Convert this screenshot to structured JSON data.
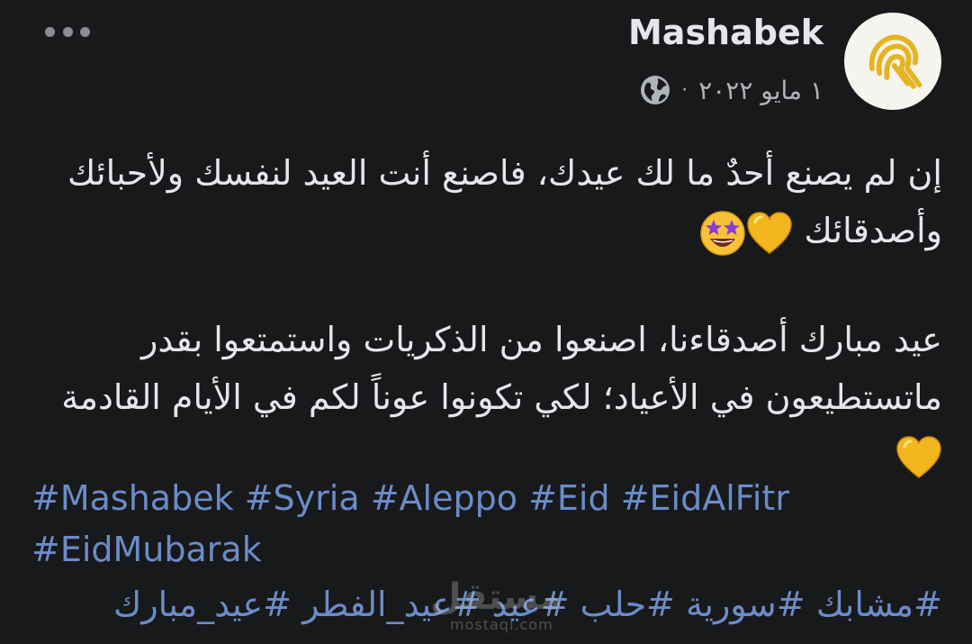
{
  "post": {
    "author": "Mashabek",
    "date": "١ مايو ٢٠٢٢",
    "separator": "·",
    "privacy_icon": "globe-icon",
    "avatar_icon": "fingerprint-logo",
    "more_icon": "more-dots-icon",
    "body": {
      "paragraph1": "إن لم يصنع أحدٌ ما لك عيدك، فاصنع أنت العيد لنفسك ولأحبائك وأصدقائك",
      "paragraph1_emojis": [
        "yellow-heart-emoji",
        "star-struck-emoji"
      ],
      "paragraph2": "عيد مبارك أصدقاءنا، اصنعوا من الذكريات واستمتعوا بقدر ماتستطيعون في الأعياد؛ لكي تكونوا عوناً لكم في الأيام القادمة",
      "paragraph2_emojis": [
        "yellow-heart-emoji"
      ]
    },
    "hashtags_en": [
      "#Mashabek",
      "#Syria",
      "#Aleppo",
      "#Eid",
      "#EidAlFitr",
      "#EidMubarak"
    ],
    "hashtags_ar": [
      "#مشابك",
      "#سورية",
      "#حلب",
      "#عيد",
      "#عيد_الفطر",
      "#عيد_مبارك"
    ]
  },
  "watermark": {
    "arabic": "مستقل",
    "latin": "mostaql.com"
  },
  "colors": {
    "background": "#18191a",
    "text": "#e4e6eb",
    "muted": "#b0b3b8",
    "hashtag": "#6b8cc9",
    "logo_gold": "#e6b422"
  }
}
